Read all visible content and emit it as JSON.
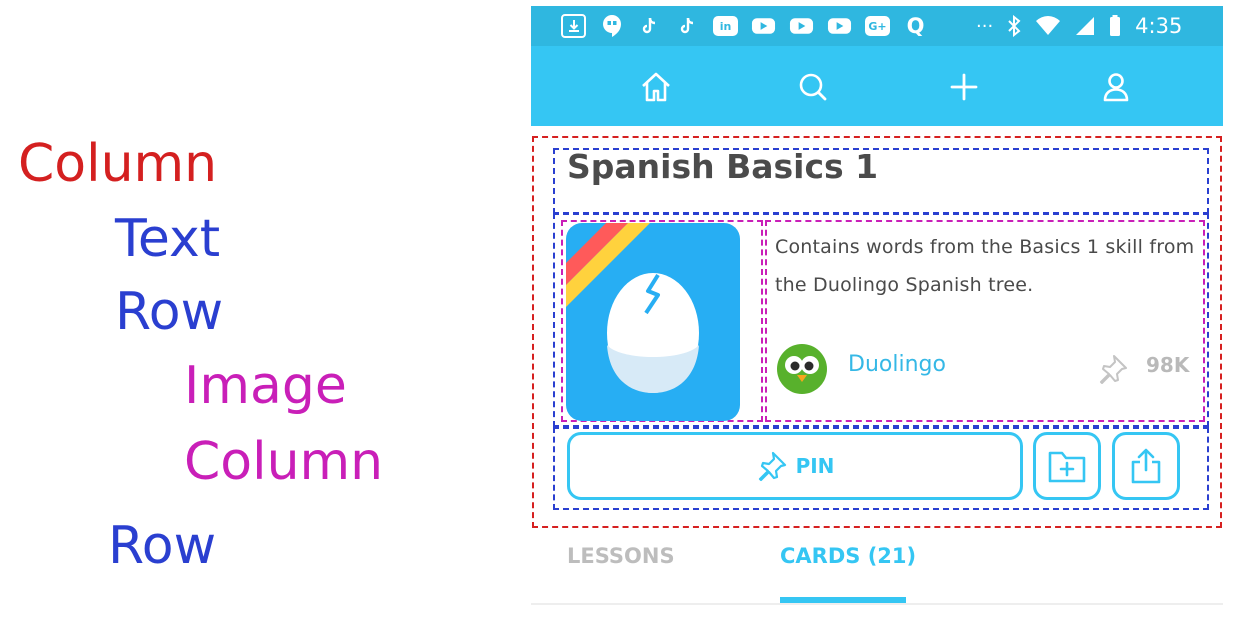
{
  "legend": {
    "items": [
      {
        "label": "Column",
        "color": "#d42020"
      },
      {
        "label": "Text",
        "color": "#2a3fd0"
      },
      {
        "label": "Row",
        "color": "#2a3fd0"
      },
      {
        "label": "Image",
        "color": "#c91fb8"
      },
      {
        "label": "Column",
        "color": "#c91fb8"
      },
      {
        "label": "Row",
        "color": "#2a3fd0"
      }
    ]
  },
  "status_bar": {
    "time": "4:35",
    "icons": [
      "download-icon",
      "hangouts-icon",
      "tiktok-icon",
      "tiktok-icon",
      "linkedin-icon",
      "youtube-icon",
      "youtube-icon",
      "youtube-icon",
      "google-plus-icon",
      "quora-icon",
      "more-icon",
      "bluetooth-icon",
      "wifi-icon",
      "signal-icon",
      "battery-icon"
    ],
    "linkedin_text": "in",
    "googleplus_text": "G+",
    "quora_text": "Q",
    "more_text": "···"
  },
  "nav": {
    "items": [
      "home-icon",
      "search-icon",
      "add-icon",
      "profile-icon"
    ]
  },
  "deck": {
    "title": "Spanish Basics 1",
    "description": "Contains words from the Basics 1 skill from the Duolingo Spanish tree.",
    "author": "Duolingo",
    "pin_count": "98K",
    "pin_button_label": "PIN"
  },
  "tabs": [
    {
      "label": "LESSONS",
      "active": false
    },
    {
      "label": "CARDS (21)",
      "active": true
    }
  ],
  "colors": {
    "accent": "#35c6f3",
    "status_bar": "#2fb7e0",
    "thumb": "#27aef3",
    "column_outline": "#d62020",
    "row_outline": "#2a3fd0",
    "image_outline": "#c91fb8"
  }
}
